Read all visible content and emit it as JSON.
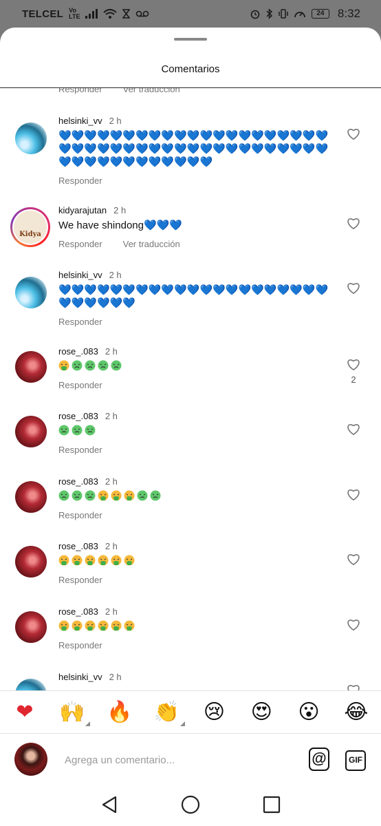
{
  "status_bar": {
    "carrier": "TELCEL",
    "network_top": "Vo",
    "network_bottom": "LTE",
    "battery": "24",
    "time": "8:32"
  },
  "sheet": {
    "title": "Comentarios"
  },
  "partial_row": {
    "reply_label": "Responder",
    "translate_label": "Ver traducción"
  },
  "comments": [
    {
      "username": "helsinki_vv",
      "time": "2 h",
      "text": "💙💙💙💙💙💙💙💙💙💙💙💙💙💙💙💙💙💙💙💙💙💙💙💙💙💙💙💙💙💙💙💙💙💙💙💙💙💙💙💙💙💙💙💙💙💙💙💙💙💙💙💙💙💙",
      "reply_label": "Responder",
      "likes": ""
    },
    {
      "username": "kidyarajutan",
      "time": "2 h",
      "text": "We have shindong💙💙💙",
      "reply_label": "Responder",
      "translate_label": "Ver traducción",
      "likes": ""
    },
    {
      "username": "helsinki_vv",
      "time": "2 h",
      "text": "💙💙💙💙💙💙💙💙💙💙💙💙💙💙💙💙💙💙💙💙💙💙💙💙💙💙💙",
      "reply_label": "Responder",
      "likes": ""
    },
    {
      "username": "rose_.083",
      "time": "2 h",
      "emoji_sequence": [
        "vomit",
        "sick",
        "sick",
        "sick",
        "sick"
      ],
      "reply_label": "Responder",
      "likes": "2"
    },
    {
      "username": "rose_.083",
      "time": "2 h",
      "emoji_sequence": [
        "sick",
        "sick",
        "sick"
      ],
      "reply_label": "Responder",
      "likes": ""
    },
    {
      "username": "rose_.083",
      "time": "2 h",
      "emoji_sequence": [
        "sick",
        "sick",
        "sick",
        "vomit",
        "vomit",
        "vomit",
        "sick",
        "sick"
      ],
      "reply_label": "Responder",
      "likes": ""
    },
    {
      "username": "rose_.083",
      "time": "2 h",
      "emoji_sequence": [
        "vomit",
        "vomit",
        "vomit",
        "vomit",
        "vomit",
        "vomit"
      ],
      "reply_label": "Responder",
      "likes": ""
    },
    {
      "username": "rose_.083",
      "time": "2 h",
      "emoji_sequence": [
        "vomit",
        "vomit",
        "vomit",
        "vomit",
        "vomit",
        "vomit"
      ],
      "reply_label": "Responder",
      "likes": ""
    },
    {
      "username": "helsinki_vv",
      "time": "2 h"
    }
  ],
  "avatars": {
    "kidya_logo_text": "Kidya"
  },
  "emoji_bar": [
    {
      "glyph": "❤",
      "name": "red-heart",
      "has_variants": false
    },
    {
      "glyph": "🙌",
      "name": "raising-hands",
      "has_variants": true
    },
    {
      "glyph": "🔥",
      "name": "fire",
      "has_variants": false
    },
    {
      "glyph": "👏",
      "name": "clapping-hands",
      "has_variants": true
    },
    {
      "glyph": "😢",
      "name": "crying-face",
      "has_variants": false
    },
    {
      "glyph": "😍",
      "name": "heart-eyes",
      "has_variants": false
    },
    {
      "glyph": "😮",
      "name": "surprised-face",
      "has_variants": false
    },
    {
      "glyph": "😂",
      "name": "tears-of-joy",
      "has_variants": false
    }
  ],
  "composer": {
    "placeholder": "Agrega un comentario...",
    "mention_label": "@",
    "gif_label": "GIF"
  },
  "colors": {
    "blue_heart": "#1f8fe6",
    "sick_face": "#5ec76a",
    "vomit_face": "#f5b83a",
    "vomit_green": "#3fae4a",
    "like_outline": "#777777"
  }
}
